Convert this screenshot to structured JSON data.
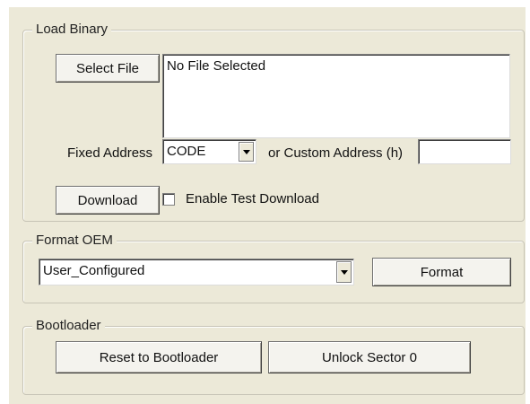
{
  "load_binary": {
    "legend": "Load Binary",
    "select_file_label": "Select File",
    "file_display": "No File Selected",
    "fixed_address_label": "Fixed Address",
    "fixed_address_value": "CODE",
    "or_custom_label": "or Custom Address (h)",
    "custom_address_value": "",
    "download_label": "Download",
    "enable_test_label": "Enable Test Download",
    "enable_test_checked": false
  },
  "format_oem": {
    "legend": "Format OEM",
    "selected_value": "User_Configured",
    "format_label": "Format"
  },
  "bootloader": {
    "legend": "Bootloader",
    "reset_label": "Reset to Bootloader",
    "unlock_label": "Unlock Sector 0"
  },
  "icons": {
    "dropdown": "chevron-down-icon",
    "checkbox": "checkbox-icon"
  }
}
